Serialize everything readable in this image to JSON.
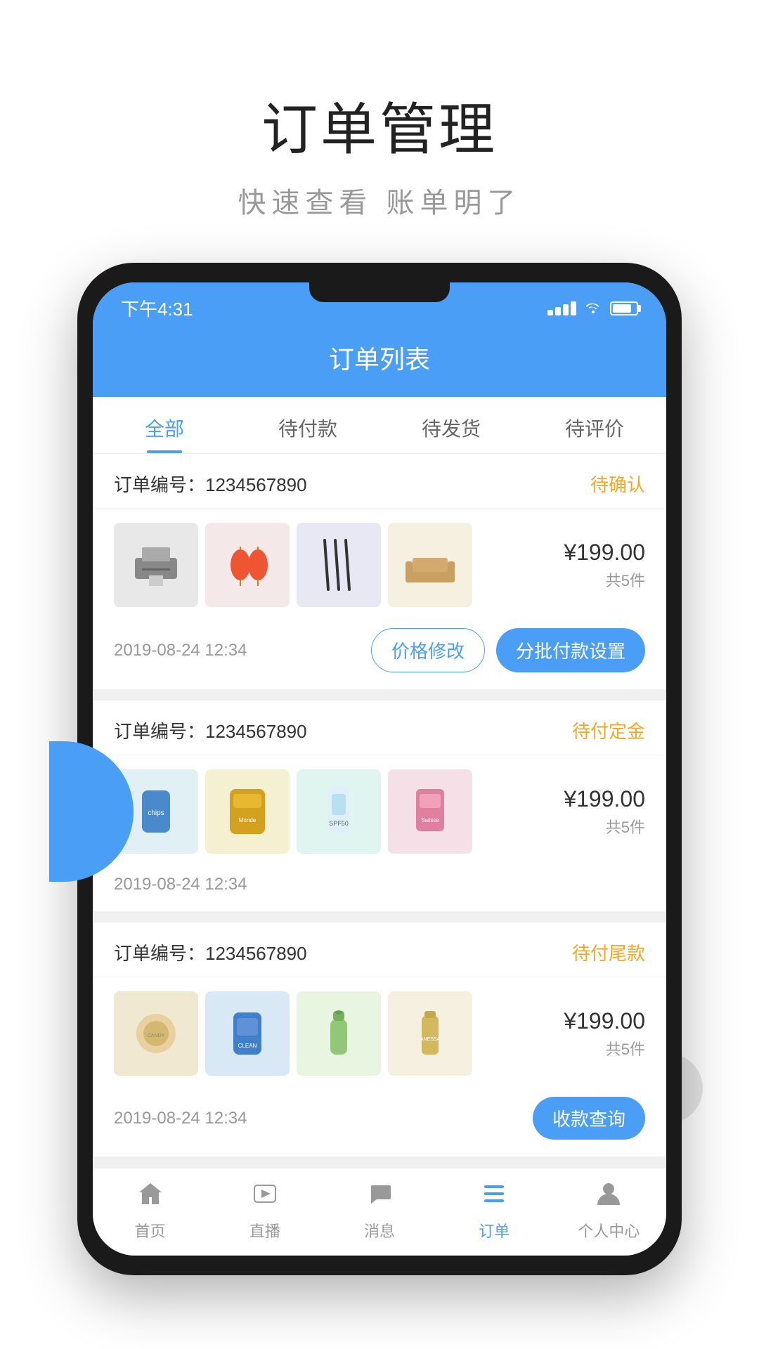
{
  "page": {
    "title": "订单管理",
    "subtitle": "快速查看  账单明了"
  },
  "statusBar": {
    "time": "下午4:31"
  },
  "appHeader": {
    "title": "订单列表"
  },
  "tabs": [
    {
      "label": "全部",
      "active": true
    },
    {
      "label": "待付款",
      "active": false
    },
    {
      "label": "待发货",
      "active": false
    },
    {
      "label": "待评价",
      "active": false
    }
  ],
  "orders": [
    {
      "id": "order-1",
      "number": "订单编号：1234567890",
      "status": "待确认",
      "statusClass": "status-confirm",
      "price": "¥199.00",
      "count": "共5件",
      "date": "2019-08-24 12:34",
      "buttons": [
        "价格修改",
        "分批付款设置"
      ],
      "buttonStyles": [
        "outline",
        "filled"
      ]
    },
    {
      "id": "order-2",
      "number": "订单编号：1234567890",
      "status": "待付定金",
      "statusClass": "status-deposit",
      "price": "¥199.00",
      "count": "共5件",
      "date": "2019-08-24 12:34",
      "buttons": [],
      "buttonStyles": []
    },
    {
      "id": "order-3",
      "number": "订单编号：1234567890",
      "status": "待付尾款",
      "statusClass": "status-final",
      "price": "¥199.00",
      "count": "共5件",
      "date": "2019-08-24 12:34",
      "buttons": [
        "收款查询"
      ],
      "buttonStyles": [
        "filled"
      ]
    }
  ],
  "bottomNav": [
    {
      "label": "首页",
      "icon": "⌂",
      "active": false
    },
    {
      "label": "直播",
      "icon": "▶",
      "active": false
    },
    {
      "label": "消息",
      "icon": "💬",
      "active": false
    },
    {
      "label": "订单",
      "icon": "≡",
      "active": true
    },
    {
      "label": "个人中心",
      "icon": "👤",
      "active": false
    }
  ]
}
